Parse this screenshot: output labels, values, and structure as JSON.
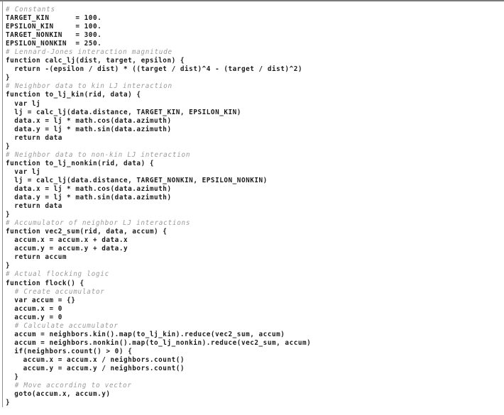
{
  "figure": {
    "kind": "code-listing",
    "language": "flocking-script",
    "border_color": "#7a7a7a",
    "text_color": "#1a1a1a",
    "comment_color": "#9a9a9a"
  },
  "code": {
    "lines": [
      {
        "text": "# Constants",
        "comment": true
      },
      {
        "text": "TARGET_KIN      = 100.",
        "comment": false
      },
      {
        "text": "EPSILON_KIN     = 100.",
        "comment": false
      },
      {
        "text": "TARGET_NONKIN   = 300.",
        "comment": false
      },
      {
        "text": "EPSILON_NONKIN  = 250.",
        "comment": false
      },
      {
        "text": "# Lennard-Jones interaction magnitude",
        "comment": true
      },
      {
        "text": "function calc_lj(dist, target, epsilon) {",
        "comment": false
      },
      {
        "text": "  return -(epsilon / dist) * ((target / dist)^4 - (target / dist)^2)",
        "comment": false
      },
      {
        "text": "}",
        "comment": false
      },
      {
        "text": "# Neighbor data to kin LJ interaction",
        "comment": true
      },
      {
        "text": "function to_lj_kin(rid, data) {",
        "comment": false
      },
      {
        "text": "  var lj",
        "comment": false
      },
      {
        "text": "  lj = calc_lj(data.distance, TARGET_KIN, EPSILON_KIN)",
        "comment": false
      },
      {
        "text": "  data.x = lj * math.cos(data.azimuth)",
        "comment": false
      },
      {
        "text": "  data.y = lj * math.sin(data.azimuth)",
        "comment": false
      },
      {
        "text": "  return data",
        "comment": false
      },
      {
        "text": "}",
        "comment": false
      },
      {
        "text": "# Neighbor data to non-kin LJ interaction",
        "comment": true
      },
      {
        "text": "function to_lj_nonkin(rid, data) {",
        "comment": false
      },
      {
        "text": "  var lj",
        "comment": false
      },
      {
        "text": "  lj = calc_lj(data.distance, TARGET_NONKIN, EPSILON_NONKIN)",
        "comment": false
      },
      {
        "text": "  data.x = lj * math.cos(data.azimuth)",
        "comment": false
      },
      {
        "text": "  data.y = lj * math.sin(data.azimuth)",
        "comment": false
      },
      {
        "text": "  return data",
        "comment": false
      },
      {
        "text": "}",
        "comment": false
      },
      {
        "text": "# Accumulator of neighbor LJ interactions",
        "comment": true
      },
      {
        "text": "function vec2_sum(rid, data, accum) {",
        "comment": false
      },
      {
        "text": "  accum.x = accum.x + data.x",
        "comment": false
      },
      {
        "text": "  accum.y = accum.y + data.y",
        "comment": false
      },
      {
        "text": "  return accum",
        "comment": false
      },
      {
        "text": "}",
        "comment": false
      },
      {
        "text": "# Actual flocking logic",
        "comment": true
      },
      {
        "text": "function flock() {",
        "comment": false
      },
      {
        "text": "  # Create accumulator",
        "comment": true
      },
      {
        "text": "  var accum = {}",
        "comment": false
      },
      {
        "text": "  accum.x = 0",
        "comment": false
      },
      {
        "text": "  accum.y = 0",
        "comment": false
      },
      {
        "text": "  # Calculate accumulator",
        "comment": true
      },
      {
        "text": "  accum = neighbors.kin().map(to_lj_kin).reduce(vec2_sum, accum)",
        "comment": false
      },
      {
        "text": "  accum = neighbors.nonkin().map(to_lj_nonkin).reduce(vec2_sum, accum)",
        "comment": false
      },
      {
        "text": "  if(neighbors.count() > 0) {",
        "comment": false
      },
      {
        "text": "    accum.x = accum.x / neighbors.count()",
        "comment": false
      },
      {
        "text": "    accum.y = accum.y / neighbors.count()",
        "comment": false
      },
      {
        "text": "  }",
        "comment": false
      },
      {
        "text": "  # Move according to vector",
        "comment": true
      },
      {
        "text": "  goto(accum.x, accum.y)",
        "comment": false
      },
      {
        "text": "}",
        "comment": false
      }
    ]
  }
}
